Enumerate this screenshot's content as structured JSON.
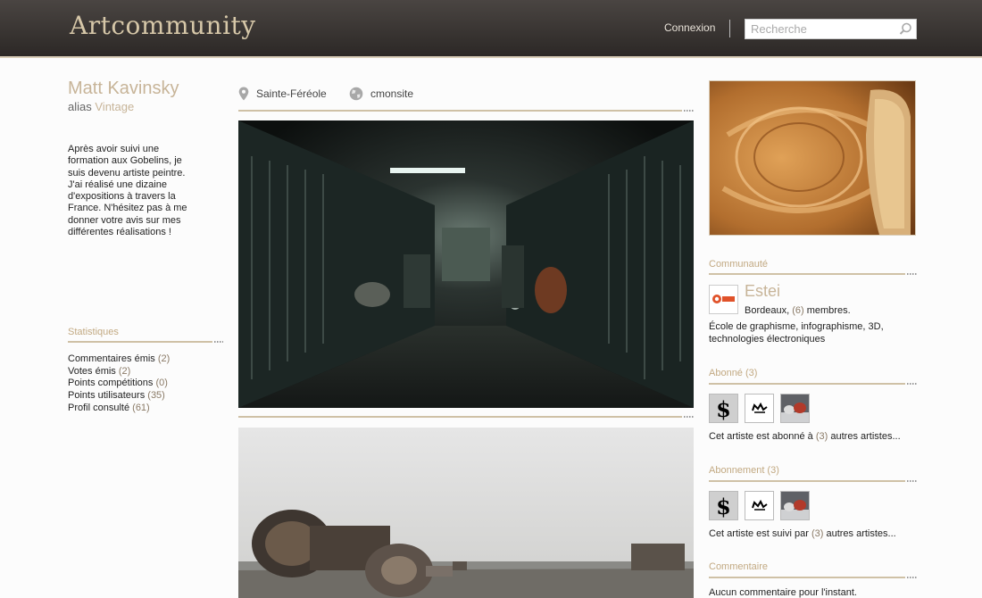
{
  "header": {
    "logo": "Artcommunity",
    "login": "Connexion",
    "search_placeholder": "Recherche"
  },
  "profile": {
    "name": "Matt Kavinsky",
    "alias_prefix": "alias",
    "alias": "Vintage",
    "bio": "Après avoir suivi une formation aux Gobelins, je suis devenu artiste peintre. J'ai réalisé une dizaine d'expositions à travers la France. N'hésitez pas à me donner votre avis sur mes différentes réalisations !"
  },
  "stats": {
    "title": "Statistiques",
    "items": [
      {
        "label": "Commentaires émis",
        "value": "(2)"
      },
      {
        "label": "Votes émis",
        "value": "(2)"
      },
      {
        "label": "Points compétitions",
        "value": "(0)"
      },
      {
        "label": "Points utilisateurs",
        "value": "(35)"
      },
      {
        "label": "Profil consulté",
        "value": "(61)"
      }
    ]
  },
  "meta": {
    "location": "Sainte-Féréole",
    "site": "cmonsite"
  },
  "community": {
    "title": "Communauté",
    "name": "Estei",
    "location": "Bordeaux,",
    "count": "(6)",
    "members": "membres.",
    "description": "École de graphisme, infographisme, 3D, technologies électroniques"
  },
  "subscribed": {
    "title": "Abonné (3)",
    "prefix": "Cet artiste est abonné à",
    "count": "(3)",
    "suffix": "autres artistes..."
  },
  "subscription": {
    "title": "Abonnement (3)",
    "prefix": "Cet artiste est suivi par",
    "count": "(3)",
    "suffix": "autres artistes..."
  },
  "comments": {
    "title": "Commentaire",
    "empty": "Aucun commentaire pour l'instant."
  }
}
